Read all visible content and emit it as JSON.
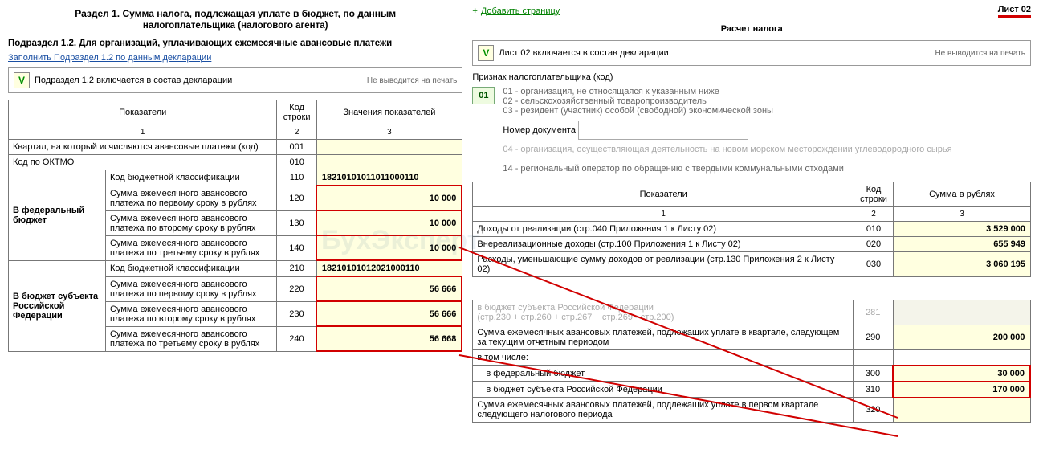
{
  "left": {
    "section_title_1": "Раздел 1. Сумма налога, подлежащая уплате в бюджет, по данным",
    "section_title_2": "налогоплательщика (налогового агента)",
    "sub12": "Подраздел 1.2. Для организаций, уплачивающих ежемесячные авансовые платежи",
    "fill_link": "Заполнить Подраздел 1.2 по данным декларации",
    "incl_text": "Подраздел 1.2 включается в состав декларации",
    "noprint": "Не выводится на печать",
    "hdr_indicators": "Показатели",
    "hdr_code": "Код строки",
    "hdr_values": "Значения показателей",
    "sub_1": "1",
    "sub_2": "2",
    "sub_3": "3",
    "quarter_label": "Квартал, на который исчисляются авансовые платежи (код)",
    "quarter_code": "001",
    "oktmo_label": "Код по ОКТМО",
    "oktmo_code": "010",
    "fed_block": "В федеральный бюджет",
    "reg_block": "В бюджет субъекта Российской Федерации",
    "kbk_label": "Код бюджетной классификации",
    "pay1": "Сумма ежемесячного авансового платежа по первому сроку в рублях",
    "pay2": "Сумма ежемесячного авансового платежа по второму сроку в рублях",
    "pay3": "Сумма ежемесячного авансового платежа по третьему сроку в рублях",
    "fed_kbk": "18210101011011000110",
    "fed_v1": "10 000",
    "fed_v2": "10 000",
    "fed_v3": "10 000",
    "reg_kbk": "18210101012021000110",
    "reg_v1": "56 666",
    "reg_v2": "56 666",
    "reg_v3": "56 668",
    "c110": "110",
    "c120": "120",
    "c130": "130",
    "c140": "140",
    "c210": "210",
    "c220": "220",
    "c230": "230",
    "c240": "240"
  },
  "right": {
    "add_page": "Добавить страницу",
    "sheet": "Лист 02",
    "calc_title": "Расчет налога",
    "incl_text": "Лист 02 включается в состав декларации",
    "noprint": "Не выводится на печать",
    "sign_label": "Признак налогоплательщика (код)",
    "code01": "01",
    "sign_opt1": "01 - организация, не относящаяся к указанным ниже",
    "sign_opt2": "02 - сельскохозяйственный товаропроизводитель",
    "sign_opt3": "03 - резидент (участник) особой (свободной) экономической зоны",
    "docnum_label": "Номер документа",
    "sign_opt4": "04 - организация, осуществляющая деятельность на новом морском месторождении углеводородного сырья",
    "sign_opt14": "14 - региональный оператор по обращению с твердыми коммунальными отходами",
    "hdr_indicators": "Показатели",
    "hdr_code": "Код строки",
    "hdr_sum": "Сумма в рублях",
    "sub_1": "1",
    "sub_2": "2",
    "sub_3": "3",
    "row010_label": "Доходы от реализации (стр.040 Приложения 1 к Листу 02)",
    "row010_code": "010",
    "row010_val": "3 529 000",
    "row020_label": "Внереализационные доходы (стр.100 Приложения 1 к Листу 02)",
    "row020_code": "020",
    "row020_val": "655 949",
    "row030_label": "Расходы, уменьшающие сумму доходов от реализации (стр.130 Приложения 2 к Листу 02)",
    "row030_code": "030",
    "row030_val": "3 060 195",
    "row281_label_a": "в бюджет субъекта Российской Федерации",
    "row281_label_b": "(стр.230 + стр.260 + стр.267 + стр.269 - стр.200)",
    "row281_code": "281",
    "row290_label": "Сумма ежемесячных авансовых платежей, подлежащих уплате в квартале, следующем за текущим отчетным периодом",
    "row290_code": "290",
    "row290_val": "200 000",
    "row_incl": "в том числе:",
    "row300_label": "в федеральный бюджет",
    "row300_code": "300",
    "row300_val": "30 000",
    "row310_label": "в бюджет субъекта Российской Федерации",
    "row310_code": "310",
    "row310_val": "170 000",
    "row320_label": "Сумма ежемесячных авансовых платежей, подлежащих уплате в первом квартале следующего налогового периода",
    "row320_code": "320"
  },
  "v": "V",
  "plus": "+"
}
